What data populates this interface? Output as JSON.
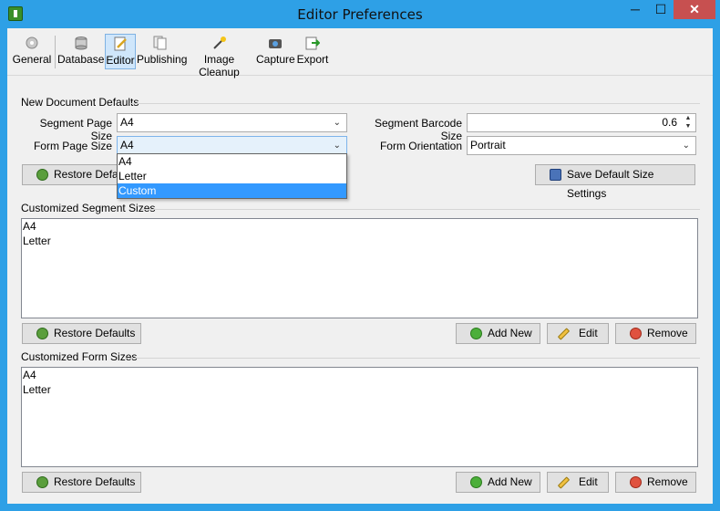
{
  "window": {
    "title": "Editor Preferences",
    "min": "─",
    "max": "☐",
    "close": "✕"
  },
  "toolbar": [
    {
      "label": "General",
      "icon": "gears-icon"
    },
    {
      "label": "Database",
      "icon": "database-icon"
    },
    {
      "label": "Editor",
      "icon": "edit-page-icon"
    },
    {
      "label": "Publishing",
      "icon": "pages-icon"
    },
    {
      "label": "Image Cleanup",
      "icon": "magic-wand-icon"
    },
    {
      "label": "Capture",
      "icon": "camera-icon"
    },
    {
      "label": "Export",
      "icon": "export-icon"
    }
  ],
  "defaults": {
    "section": "New Document Defaults",
    "segment_page_size_label": "Segment Page Size",
    "segment_page_size_value": "A4",
    "form_page_size_label": "Form Page Size",
    "form_page_size_value": "A4",
    "segment_barcode_size_label": "Segment Barcode Size",
    "segment_barcode_size_value": "0.6",
    "form_orientation_label": "Form Orientation",
    "form_orientation_value": "Portrait",
    "restore_label": "Restore Defaults",
    "save_label": "Save Default Size Settings"
  },
  "dropdown": {
    "options": [
      "A4",
      "Letter",
      "Custom"
    ],
    "selected": "Custom"
  },
  "segment_sizes": {
    "section": "Customized Segment Sizes",
    "items": [
      "A4",
      "Letter"
    ],
    "restore_label": "Restore Defaults",
    "add_label": "Add New",
    "edit_label": "Edit",
    "remove_label": "Remove"
  },
  "form_sizes": {
    "section": "Customized Form Sizes",
    "items": [
      "A4",
      "Letter"
    ],
    "restore_label": "Restore Defaults",
    "add_label": "Add New",
    "edit_label": "Edit",
    "remove_label": "Remove"
  },
  "colors": {
    "titlebar": "#2ea0e6",
    "selection": "#3399ff",
    "close": "#c75050"
  }
}
